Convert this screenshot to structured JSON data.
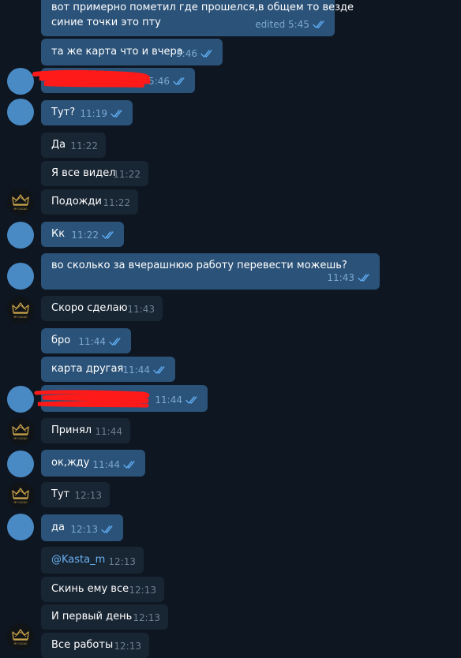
{
  "messages": [
    {
      "text1": "вот примерно пометил где прошелся,в общем то везде",
      "text2": "синие точки это пту",
      "time": "edited 5:45"
    },
    {
      "text": "та же карта что и вчера",
      "time": "5:46"
    },
    {
      "text": "",
      "time": "5:46"
    },
    {
      "text": "Тут?",
      "time": "11:19"
    },
    {
      "text": "Да",
      "time": "11:22"
    },
    {
      "text": "Я все видел",
      "time": "11:22"
    },
    {
      "text": "Подожди",
      "time": "11:22"
    },
    {
      "text": "Кк",
      "time": "11:22"
    },
    {
      "text": "во сколько за вчерашнюю работу перевести можешь?",
      "time": "11:43"
    },
    {
      "text": "Скоро сделаю",
      "time": "11:43"
    },
    {
      "text": "бро",
      "time": "11:44"
    },
    {
      "text": "карта другая",
      "time": "11:44"
    },
    {
      "text": "",
      "time": "11:44"
    },
    {
      "text": "Принял",
      "time": "11:44"
    },
    {
      "text": "ок,жду",
      "time": "11:44"
    },
    {
      "text": "Тут",
      "time": "12:13"
    },
    {
      "text": "да",
      "time": "12:13"
    },
    {
      "text": "@Kasta_m",
      "time": "12:13"
    },
    {
      "text": "Скинь ему все",
      "time": "12:13"
    },
    {
      "text": "И первый день",
      "time": "12:13"
    },
    {
      "text": "Все работы",
      "time": "12:13"
    }
  ],
  "avatar_logo_text": "MY CACAO",
  "colors": {
    "background": "#0e1621",
    "outgoing": "#2b5278",
    "incoming": "#182533",
    "accent": "#6ab2f2"
  }
}
